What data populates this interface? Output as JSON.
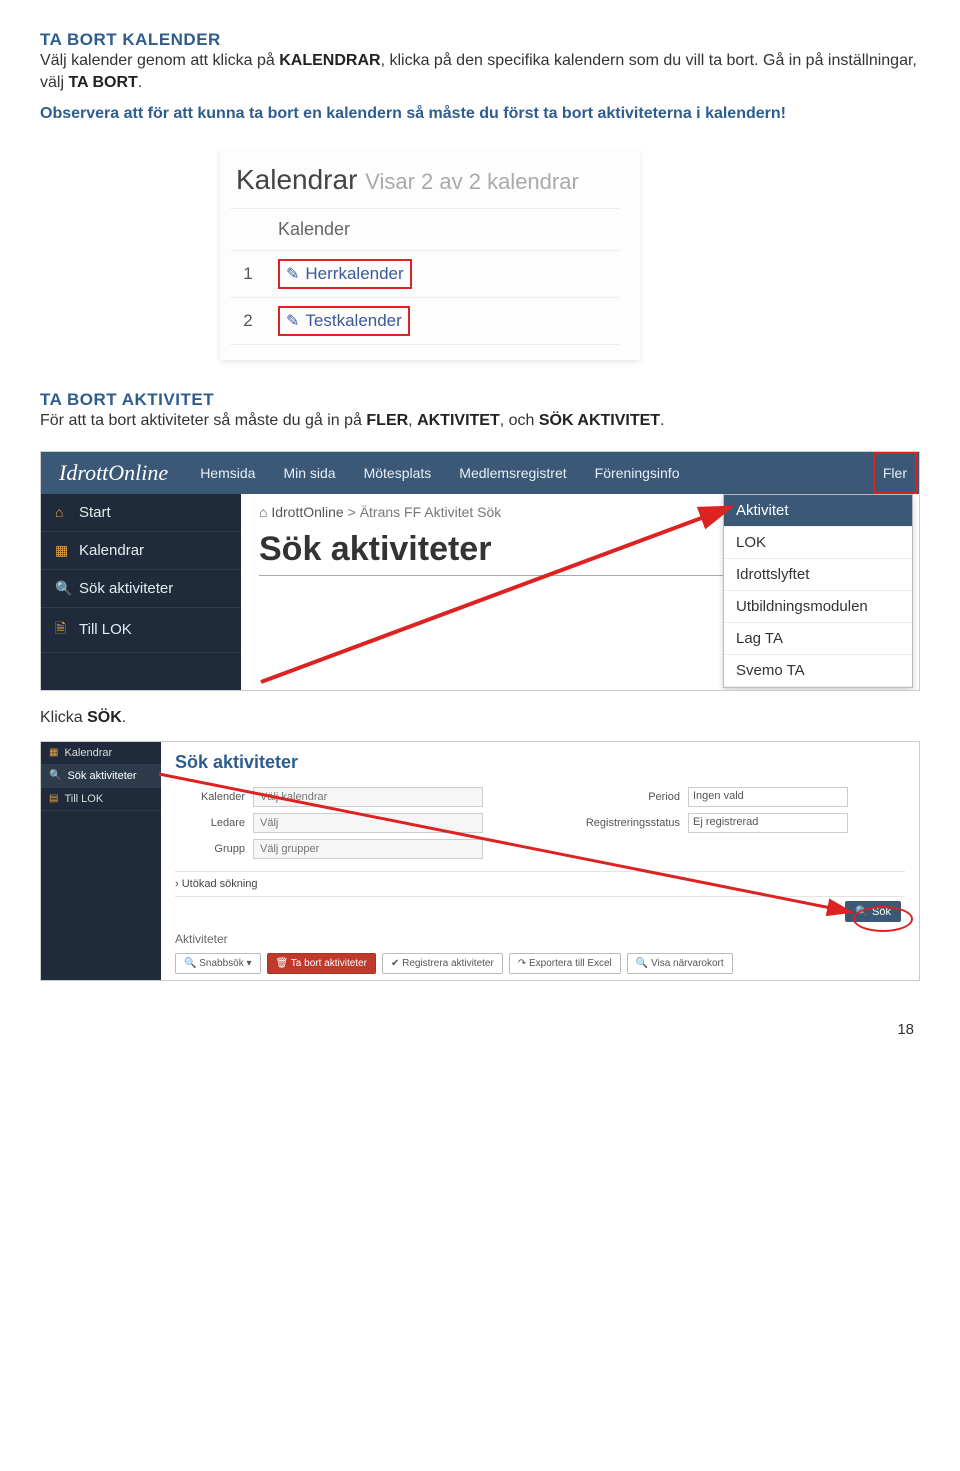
{
  "section1": {
    "heading": "TA BORT KALENDER",
    "line1a": "Välj kalender genom att klicka på ",
    "line1b": "KALENDRAR",
    "line1c": ", klicka på den specifika kalendern som du vill ta bort. Gå in på inställningar, välj ",
    "line1d": "TA BORT",
    "line1e": ".",
    "note": "Observera att för att kunna ta bort en kalendern så måste du först ta bort aktiviteterna i kalendern!"
  },
  "panel1": {
    "title_a": "Kalendrar",
    "title_b": "Visar 2 av 2 kalendrar",
    "col_header": "Kalender",
    "rows": [
      {
        "n": "1",
        "name": "Herrkalender"
      },
      {
        "n": "2",
        "name": "Testkalender"
      }
    ]
  },
  "section2": {
    "heading": "TA BORT AKTIVITET",
    "line_a": "För att ta bort aktiviteter så måste du gå in på ",
    "b1": "FLER",
    "sep1": ", ",
    "b2": "AKTIVITET",
    "sep2": ", och ",
    "b3": "SÖK AKTIVITET",
    "end": "."
  },
  "panel2": {
    "logo": "IdrottOnline",
    "nav": [
      "Hemsida",
      "Min sida",
      "Mötesplats",
      "Medlemsregistret",
      "Föreningsinfo",
      "Fler"
    ],
    "left": [
      {
        "icon": "⌂",
        "label": "Start"
      },
      {
        "icon": "▦",
        "label": "Kalendrar"
      },
      {
        "icon": "🔍",
        "label": "Sök aktiviteter"
      },
      {
        "icon": "🗎",
        "label": "Till LOK"
      }
    ],
    "dropdown": [
      "Aktivitet",
      "LOK",
      "Idrottslyftet",
      "Utbildningsmodulen",
      "Lag TA",
      "Svemo TA"
    ],
    "crumb_home": "⌂ IdrottOnline",
    "crumb_rest": "Ätrans FF   Aktivitet   Sök",
    "title": "Sök aktiviteter"
  },
  "section3": {
    "line_a": "Klicka ",
    "b1": "SÖK",
    "end": "."
  },
  "panel3": {
    "left": [
      {
        "icon": "▦",
        "label": "Kalendrar"
      },
      {
        "icon": "🔍",
        "label": "Sök aktiviteter"
      },
      {
        "icon": "▤",
        "label": "Till LOK"
      }
    ],
    "title": "Sök aktiviteter",
    "labels": {
      "kalender": "Kalender",
      "ledare": "Ledare",
      "grupp": "Grupp",
      "period": "Period",
      "regstatus": "Registreringsstatus"
    },
    "placeholders": {
      "kalender": "Välj kalendrar",
      "ledare": "Välj",
      "grupp": "Välj grupper",
      "period": "Ingen vald",
      "regstatus": "Ej registrerad"
    },
    "expand": "› Utökad sökning",
    "sok_btn": "🔍 Sök",
    "aktiv_head": "Aktiviteter",
    "buttons": {
      "snabb": "🔍 Snabbsök ▾",
      "tabort": "🗑 Ta bort aktiviteter",
      "reg": "✔ Registrera aktiviteter",
      "export": "↷ Exportera till Excel",
      "visa": "🔍 Visa närvarokort"
    }
  },
  "page_number": "18"
}
